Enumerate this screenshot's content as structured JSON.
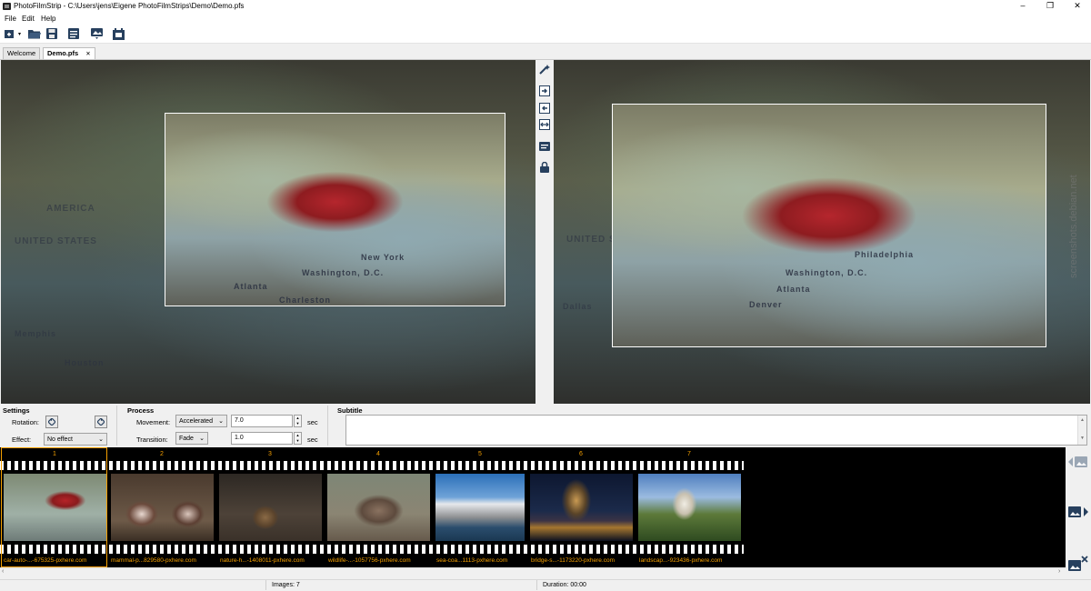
{
  "window": {
    "title": "PhotoFilmStrip - C:\\Users\\jens\\Eigene PhotoFilmStrips\\Demo\\Demo.pfs",
    "minimize": "–",
    "maximize": "❐",
    "close": "✕"
  },
  "menu": [
    "File",
    "Edit",
    "Help"
  ],
  "tabs": [
    {
      "label": "Welcome"
    },
    {
      "label": "Demo.pfs",
      "close": "✕"
    }
  ],
  "settings": {
    "header": "Settings",
    "rotation_label": "Rotation:",
    "effect_label": "Effect:",
    "effect_value": "No effect"
  },
  "process": {
    "header": "Process",
    "movement_label": "Movement:",
    "movement_value": "Accelerated",
    "movement_duration": "7.0",
    "transition_label": "Transition:",
    "transition_value": "Fade",
    "transition_duration": "1.0",
    "unit": "sec"
  },
  "subtitle": {
    "header": "Subtitle",
    "value": ""
  },
  "filmstrip": [
    {
      "num": "1",
      "caption": "car-auto-...-675325-pxhere.com"
    },
    {
      "num": "2",
      "caption": "mammal-p...829580-pxhere.com"
    },
    {
      "num": "3",
      "caption": "nature-h...-1408011-pxhere.com"
    },
    {
      "num": "4",
      "caption": "wildlife-...-1057756-pxhere.com"
    },
    {
      "num": "5",
      "caption": "sea-coa...1113-pxhere.com"
    },
    {
      "num": "6",
      "caption": "bridge-s...-1173220-pxhere.com"
    },
    {
      "num": "7",
      "caption": "landscap...-923436-pxhere.com"
    }
  ],
  "status": {
    "images": "Images: 7",
    "duration": "Duration: 00:00"
  },
  "watermark": "screenshots.debian.net",
  "map_labels": [
    "UNITED STATES",
    "AMERICA",
    "Washington, D.C.",
    "Atlanta",
    "Denver",
    "New York",
    "Philadelphia",
    "Charleston",
    "Memphis",
    "Dallas",
    "Houston"
  ],
  "colors": {
    "accent_orange": "#f5a000",
    "film_black": "#000000",
    "selection_white": "#ffffff"
  }
}
